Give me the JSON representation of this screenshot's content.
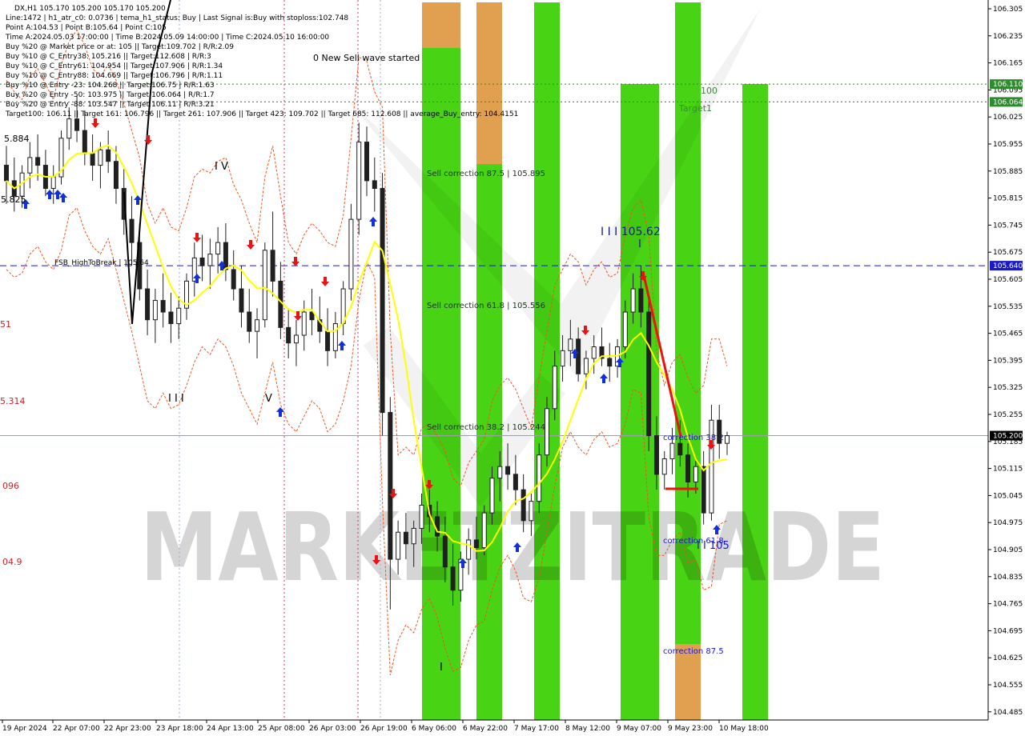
{
  "chart_data": {
    "type": "candlestick",
    "symbol_title": "DX,H1  105.170 105.200 105.170 105.200",
    "info_lines": [
      "Line:1472 | h1_atr_c0: 0.0736 | tema_h1_status: Buy | Last Signal is:Buy with stoploss:102.748",
      "Point A:104.53 | Point B:105.64 | Point C:105",
      "Time A:2024.05.03 17:00:00 | Time B:2024.05.09 14:00:00 | Time C:2024.05.10 16:00:00",
      "Buy %20 @ Market price or at: 105 || Target:109.702 | R/R:2.09",
      "Buy %10 @ C_Entry38: 105.216 || Target:112.608 | R/R:3",
      "Buy %10 @ C_Entry61: 104.954 || Target:107.906 | R/R:1.34",
      "Buy %10 @ C_Entry88: 104.669 || Target:106.796 | R/R:1.11",
      "Buy %10 @ Entry -23: 104.268 || Target:106.75 | R/R:1.63",
      "Buy %20 @ Entry -50: 103.975 || Target:106.064 | R/R:1.7",
      "Buy %20 @ Entry -88: 103.547 || Target:106.11 | R/R:3.21",
      "Target100: 106.11 || Target 161: 106.796 || Target 261: 107.906 || Target 423: 109.702 || Target 685: 112.608 || average_Buy_entry: 104.4151"
    ],
    "y_axis_ticks": [
      "106.305",
      "106.235",
      "106.165",
      "106.095",
      "106.025",
      "105.955",
      "105.885",
      "105.815",
      "105.745",
      "105.675",
      "105.605",
      "105.535",
      "105.465",
      "105.395",
      "105.325",
      "105.255",
      "105.185",
      "105.115",
      "105.045",
      "104.975",
      "104.905",
      "104.835",
      "104.765",
      "104.695",
      "104.625",
      "104.555",
      "104.485"
    ],
    "ylim": [
      104.485,
      106.305
    ],
    "x_axis_ticks": [
      "19 Apr 2024",
      "22 Apr 07:00",
      "22 Apr 23:00",
      "23 Apr 18:00",
      "24 Apr 13:00",
      "25 Apr 08:00",
      "26 Apr 03:00",
      "26 Apr 19:00",
      "6 May 06:00",
      "6 May 22:00",
      "7 May 17:00",
      "8 May 12:00",
      "9 May 07:00",
      "9 May 23:00",
      "10 May 18:00"
    ],
    "price_levels": [
      {
        "label": "106.110",
        "value": 106.11,
        "style": "dotted",
        "color": "#2e8b2e"
      },
      {
        "label": "106.064",
        "value": 106.064,
        "style": "dotted",
        "color": "#2e8b2e"
      },
      {
        "label": "105.640",
        "value": 105.64,
        "style": "dashed",
        "color": "#1a1acd"
      },
      {
        "label": "105.200",
        "value": 105.2,
        "style": "solid",
        "color": "#9aa0a6"
      }
    ],
    "annotations": [
      {
        "text": "0 New Sell wave started",
        "color": "#000000"
      },
      {
        "text": "Sell correction 87.5 | 105.895",
        "color": "#1f2f1f"
      },
      {
        "text": "Sell correction 61.8 | 105.556",
        "color": "#1f2f1f"
      },
      {
        "text": "Sell correction 38.2 | 105.244",
        "color": "#1f2f1f"
      },
      {
        "text": "I I I 105.62",
        "color": "#1a1a8c"
      },
      {
        "text": "100",
        "color": "#3a8a3a"
      },
      {
        "text": "Target1",
        "color": "#3a8a3a"
      },
      {
        "text": "FSB_HighToBreak | 105.64",
        "color": "#000000"
      },
      {
        "text": "correction 38.2",
        "color": "#1a1acd"
      },
      {
        "text": "correction 61.8",
        "color": "#1a1acd"
      },
      {
        "text": "correction 87.5",
        "color": "#1a1acd"
      },
      {
        "text": "I I 105",
        "color": "#1a1acd"
      },
      {
        "text": "I V",
        "color": "#000000"
      },
      {
        "text": "I I I",
        "color": "#000000"
      },
      {
        "text": "V",
        "color": "#000000"
      },
      {
        "text": "I",
        "color": "#000000"
      },
      {
        "text": "I",
        "color": "#1a1a8c"
      }
    ],
    "left_edge_labels": [
      {
        "text": "5.884",
        "color": "#000000"
      },
      {
        "text": "5.825",
        "color": "#000000"
      },
      {
        "text": "51",
        "color": "#cc2222"
      },
      {
        "text": "5.314",
        "color": "#cc2222"
      },
      {
        "text": "096",
        "color": "#cc2222"
      },
      {
        "text": "04.9",
        "color": "#cc2222"
      }
    ],
    "watermark": "MARKETZITRADE",
    "colors": {
      "bull_zone": "#48d414",
      "bear_zone": "#e0a050",
      "ma_line": "#ffff00",
      "sell_line": "#ee1111",
      "buy_arrow": "#1030e0",
      "sell_arrow": "#ee1111",
      "envelope": "#ee5522",
      "candle": "#202020"
    },
    "candles": [
      [
        105.9,
        105.95,
        105.8,
        105.86
      ],
      [
        105.86,
        105.92,
        105.78,
        105.82
      ],
      [
        105.82,
        105.9,
        105.79,
        105.88
      ],
      [
        105.88,
        105.96,
        105.84,
        105.92
      ],
      [
        105.92,
        105.98,
        105.86,
        105.9
      ],
      [
        105.9,
        105.94,
        105.82,
        105.84
      ],
      [
        105.84,
        105.9,
        105.8,
        105.87
      ],
      [
        105.87,
        105.99,
        105.85,
        105.97
      ],
      [
        105.97,
        106.05,
        105.94,
        106.02
      ],
      [
        106.02,
        106.08,
        105.96,
        105.99
      ],
      [
        105.99,
        106.04,
        105.9,
        105.93
      ],
      [
        105.93,
        105.98,
        105.86,
        105.9
      ],
      [
        105.9,
        105.96,
        105.84,
        105.94
      ],
      [
        105.94,
        105.99,
        105.88,
        105.91
      ],
      [
        105.91,
        105.95,
        105.8,
        105.84
      ],
      [
        105.84,
        105.89,
        105.72,
        105.76
      ],
      [
        105.76,
        105.82,
        105.64,
        105.7
      ],
      [
        105.7,
        105.75,
        105.55,
        105.58
      ],
      [
        105.58,
        105.63,
        105.46,
        105.5
      ],
      [
        105.5,
        105.58,
        105.44,
        105.55
      ],
      [
        105.55,
        105.62,
        105.48,
        105.52
      ],
      [
        105.52,
        105.57,
        105.44,
        105.49
      ],
      [
        105.49,
        105.56,
        105.45,
        105.53
      ],
      [
        105.53,
        105.62,
        105.5,
        105.6
      ],
      [
        105.6,
        105.7,
        105.56,
        105.66
      ],
      [
        105.66,
        105.72,
        105.6,
        105.64
      ],
      [
        105.64,
        105.71,
        105.58,
        105.67
      ],
      [
        105.67,
        105.74,
        105.62,
        105.7
      ],
      [
        105.7,
        105.75,
        105.6,
        105.63
      ],
      [
        105.63,
        105.68,
        105.55,
        105.58
      ],
      [
        105.58,
        105.64,
        105.48,
        105.52
      ],
      [
        105.52,
        105.58,
        105.44,
        105.47
      ],
      [
        105.47,
        105.53,
        105.4,
        105.5
      ],
      [
        105.5,
        105.7,
        105.48,
        105.68
      ],
      [
        105.68,
        105.78,
        105.56,
        105.6
      ],
      [
        105.6,
        105.65,
        105.45,
        105.48
      ],
      [
        105.48,
        105.53,
        105.4,
        105.44
      ],
      [
        105.44,
        105.5,
        105.38,
        105.46
      ],
      [
        105.46,
        105.55,
        105.42,
        105.52
      ],
      [
        105.52,
        105.58,
        105.46,
        105.5
      ],
      [
        105.5,
        105.56,
        105.44,
        105.47
      ],
      [
        105.47,
        105.53,
        105.38,
        105.42
      ],
      [
        105.42,
        105.52,
        105.4,
        105.49
      ],
      [
        105.49,
        105.6,
        105.46,
        105.58
      ],
      [
        105.58,
        105.8,
        105.55,
        105.76
      ],
      [
        105.76,
        106.01,
        105.72,
        105.96
      ],
      [
        105.96,
        106.0,
        105.82,
        105.86
      ],
      [
        105.86,
        105.92,
        105.78,
        105.84
      ],
      [
        105.84,
        105.88,
        105.2,
        105.26
      ],
      [
        105.26,
        105.3,
        104.75,
        104.88
      ],
      [
        104.88,
        104.98,
        104.84,
        104.95
      ],
      [
        104.95,
        105.0,
        104.88,
        104.92
      ],
      [
        104.92,
        104.98,
        104.86,
        104.96
      ],
      [
        104.96,
        105.05,
        104.92,
        105.02
      ],
      [
        105.02,
        105.06,
        104.95,
        104.99
      ],
      [
        104.99,
        105.03,
        104.9,
        104.94
      ],
      [
        104.94,
        104.99,
        104.82,
        104.86
      ],
      [
        104.86,
        104.92,
        104.76,
        104.8
      ],
      [
        104.8,
        104.9,
        104.77,
        104.88
      ],
      [
        104.88,
        104.96,
        104.84,
        104.93
      ],
      [
        104.93,
        104.99,
        104.88,
        104.91
      ],
      [
        104.91,
        105.02,
        104.89,
        105.0
      ],
      [
        105.0,
        105.12,
        104.97,
        105.09
      ],
      [
        105.09,
        105.16,
        105.03,
        105.12
      ],
      [
        105.12,
        105.18,
        105.06,
        105.1
      ],
      [
        105.1,
        105.15,
        105.02,
        105.06
      ],
      [
        105.06,
        105.1,
        104.95,
        104.98
      ],
      [
        104.98,
        105.05,
        104.94,
        105.03
      ],
      [
        105.03,
        105.18,
        105.0,
        105.15
      ],
      [
        105.15,
        105.3,
        105.12,
        105.27
      ],
      [
        105.27,
        105.42,
        105.24,
        105.38
      ],
      [
        105.38,
        105.46,
        105.34,
        105.42
      ],
      [
        105.42,
        105.5,
        105.38,
        105.45
      ],
      [
        105.45,
        105.48,
        105.34,
        105.36
      ],
      [
        105.36,
        105.42,
        105.32,
        105.4
      ],
      [
        105.4,
        105.46,
        105.36,
        105.43
      ],
      [
        105.43,
        105.48,
        105.38,
        105.4
      ],
      [
        105.4,
        105.44,
        105.34,
        105.38
      ],
      [
        105.38,
        105.45,
        105.35,
        105.43
      ],
      [
        105.43,
        105.55,
        105.4,
        105.52
      ],
      [
        105.52,
        105.62,
        105.49,
        105.58
      ],
      [
        105.58,
        105.64,
        105.48,
        105.52
      ],
      [
        105.52,
        105.55,
        105.16,
        105.2
      ],
      [
        105.2,
        105.25,
        105.06,
        105.1
      ],
      [
        105.1,
        105.16,
        105.06,
        105.14
      ],
      [
        105.14,
        105.22,
        105.1,
        105.18
      ],
      [
        105.18,
        105.24,
        105.12,
        105.15
      ],
      [
        105.15,
        105.18,
        105.04,
        105.08
      ],
      [
        105.08,
        105.14,
        105.05,
        105.12
      ],
      [
        105.12,
        105.16,
        104.97,
        105.0
      ],
      [
        105.0,
        105.28,
        104.98,
        105.24
      ],
      [
        105.24,
        105.28,
        105.14,
        105.18
      ],
      [
        105.18,
        105.21,
        105.15,
        105.2
      ]
    ]
  }
}
